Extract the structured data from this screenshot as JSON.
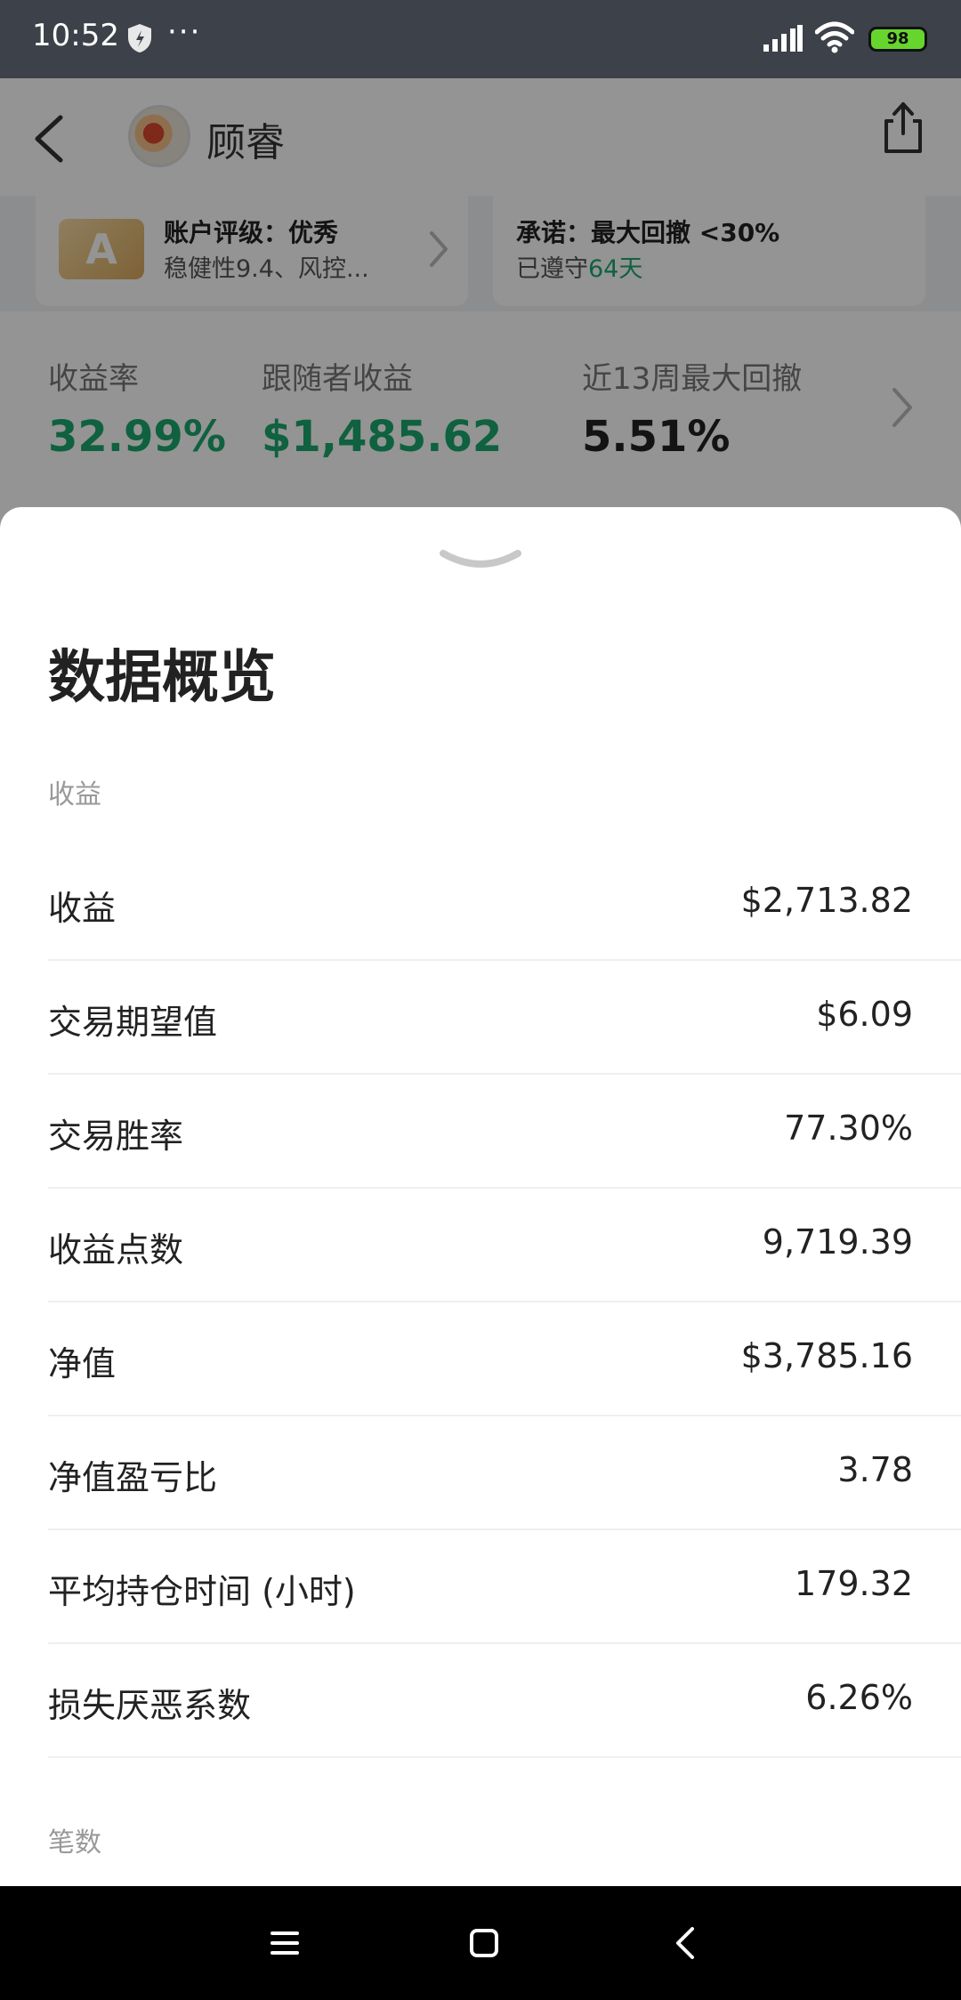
{
  "status_bar": {
    "time": "10:52",
    "more": "···",
    "battery": "98"
  },
  "nav": {
    "title": "顾睿"
  },
  "cards": {
    "rating": {
      "badge": "A",
      "title": "账户评级：优秀",
      "subtitle": "稳健性9.4、风控..."
    },
    "promise": {
      "title": "承诺：最大回撤 <30%",
      "subtitle_prefix": "已遵守",
      "days": "64天"
    }
  },
  "stats": [
    {
      "label": "收益率",
      "value": "32.99%"
    },
    {
      "label": "跟随者收益",
      "value": "$1,485.62"
    },
    {
      "label": "近13周最大回撤",
      "value": "5.51%"
    }
  ],
  "sheet": {
    "title": "数据概览",
    "section_earnings": "收益",
    "section_count": "笔数",
    "metrics": [
      {
        "label": "收益",
        "value": "$2,713.82"
      },
      {
        "label": "交易期望值",
        "value": "$6.09"
      },
      {
        "label": "交易胜率",
        "value": "77.30%"
      },
      {
        "label": "收益点数",
        "value": "9,719.39"
      },
      {
        "label": "净值",
        "value": "$3,785.16"
      },
      {
        "label": "净值盈亏比",
        "value": "3.78"
      },
      {
        "label": "平均持仓时间 (小时)",
        "value": "179.32"
      },
      {
        "label": "损失厌恶系数",
        "value": "6.26%"
      }
    ]
  },
  "colors": {
    "accent_green": "#1aa86d",
    "battery_green": "#66d62e",
    "status_bar": "#3d4149"
  },
  "icons": {
    "back": "chevron-left-icon",
    "share": "share-icon",
    "handle": "chevron-down-icon",
    "shield": "shield-icon",
    "signal": "signal-icon",
    "wifi": "wifi-icon",
    "sys_menu": "menu-icon",
    "sys_home": "home-icon",
    "sys_back": "back-icon"
  }
}
